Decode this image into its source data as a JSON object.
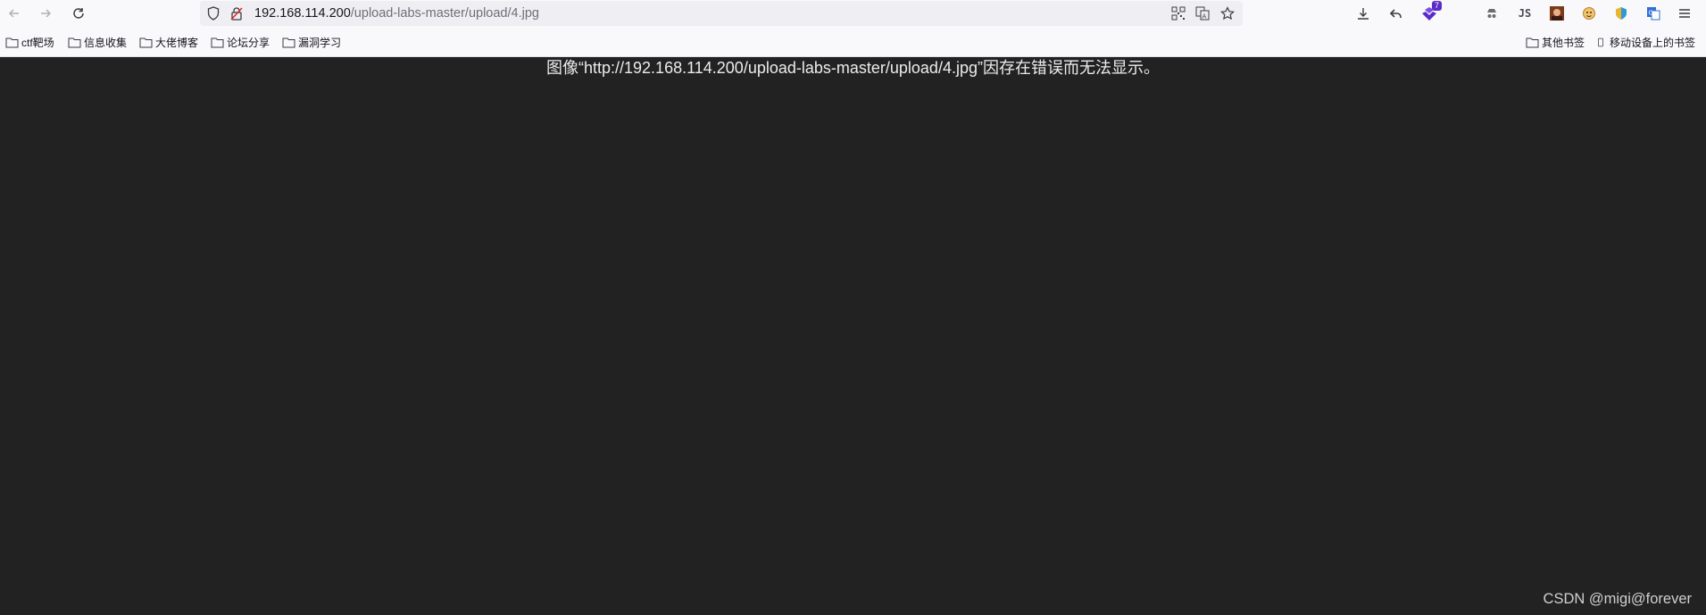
{
  "toolbar": {
    "back_icon": "arrow-left-icon",
    "forward_icon": "arrow-right-icon",
    "reload_icon": "reload-icon",
    "url_host": "192.168.114.200",
    "url_path": "/upload-labs-master/upload/4.jpg",
    "extension_badge": "7"
  },
  "bookmarks": {
    "items": [
      {
        "label": "ctf靶场"
      },
      {
        "label": "信息收集"
      },
      {
        "label": "大佬博客"
      },
      {
        "label": "论坛分享"
      },
      {
        "label": "漏洞学习"
      }
    ],
    "other_label": "其他书签",
    "mobile_label": "移动设备上的书签"
  },
  "content": {
    "error_message": "图像“http://192.168.114.200/upload-labs-master/upload/4.jpg”因存在错误而无法显示。",
    "watermark": "CSDN @migi@forever"
  },
  "colors": {
    "page_background": "#222222",
    "toolbar_background": "#f9f9fb",
    "urlbar_background": "#efeff3",
    "badge_purple": "#5b2bc9"
  }
}
